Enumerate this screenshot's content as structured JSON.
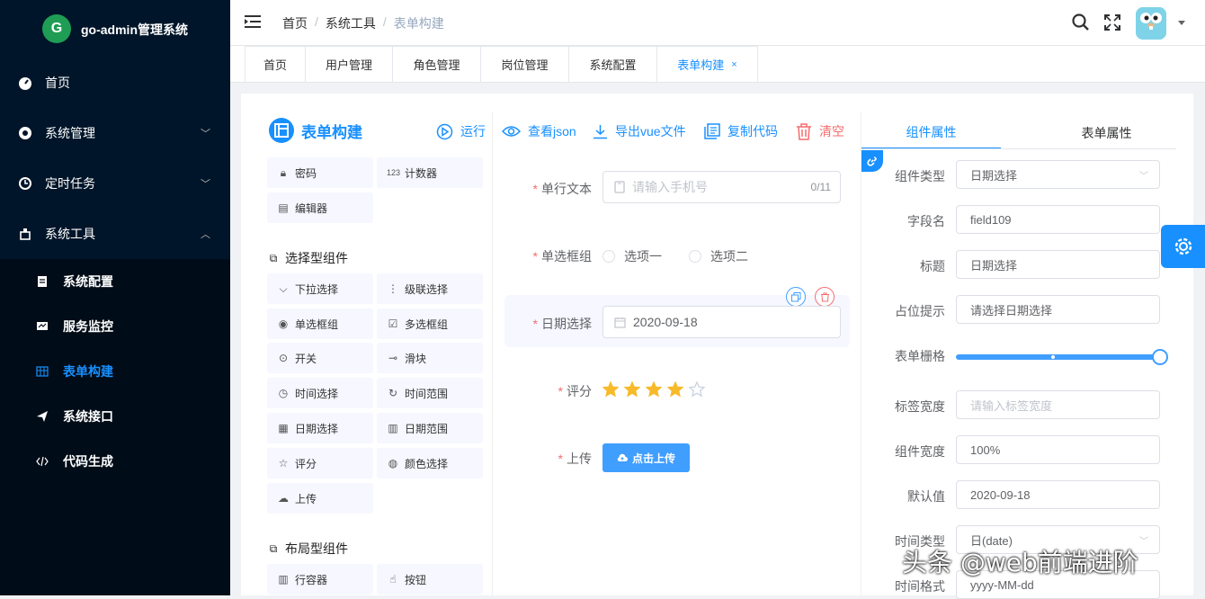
{
  "app": {
    "name": "go-admin管理系统",
    "logo_letter": "G"
  },
  "sidebar": {
    "items": [
      {
        "label": "首页",
        "icon": "dashboard-icon"
      },
      {
        "label": "系统管理",
        "icon": "gear-icon"
      },
      {
        "label": "定时任务",
        "icon": "clock-icon"
      },
      {
        "label": "系统工具",
        "icon": "tool-icon"
      }
    ],
    "sub_items": [
      {
        "label": "系统配置",
        "icon": "config-icon"
      },
      {
        "label": "服务监控",
        "icon": "monitor-icon"
      },
      {
        "label": "表单构建",
        "icon": "table-icon"
      },
      {
        "label": "系统接口",
        "icon": "send-icon"
      },
      {
        "label": "代码生成",
        "icon": "code-icon"
      }
    ]
  },
  "breadcrumb": [
    "首页",
    "系统工具",
    "表单构建"
  ],
  "breadcrumb_sep": "/",
  "tabs": [
    "首页",
    "用户管理",
    "角色管理",
    "岗位管理",
    "系统配置",
    "表单构建"
  ],
  "tab_close": "×",
  "builder": {
    "title": "表单构建",
    "toolbar": {
      "run": "运行",
      "json": "查看json",
      "export": "导出vue文件",
      "copy": "复制代码",
      "clear": "清空"
    }
  },
  "components": {
    "input_group": [
      {
        "label": "密码",
        "icon": "lock-icon"
      },
      {
        "label": "计数器",
        "icon": "counter-icon"
      },
      {
        "label": "编辑器",
        "icon": "editor-icon"
      }
    ],
    "select_title": "选择型组件",
    "select_group": [
      {
        "label": "下拉选择",
        "icon": "select-icon"
      },
      {
        "label": "级联选择",
        "icon": "cascader-icon"
      },
      {
        "label": "单选框组",
        "icon": "radio-icon"
      },
      {
        "label": "多选框组",
        "icon": "checkbox-icon"
      },
      {
        "label": "开关",
        "icon": "switch-icon"
      },
      {
        "label": "滑块",
        "icon": "slider-icon"
      },
      {
        "label": "时间选择",
        "icon": "time-icon"
      },
      {
        "label": "时间范围",
        "icon": "time-range-icon"
      },
      {
        "label": "日期选择",
        "icon": "date-icon"
      },
      {
        "label": "日期范围",
        "icon": "date-range-icon"
      },
      {
        "label": "评分",
        "icon": "star-icon"
      },
      {
        "label": "颜色选择",
        "icon": "palette-icon"
      },
      {
        "label": "上传",
        "icon": "upload-icon"
      }
    ],
    "layout_title": "布局型组件",
    "layout_group": [
      {
        "label": "行容器",
        "icon": "row-icon"
      },
      {
        "label": "按钮",
        "icon": "button-icon"
      }
    ]
  },
  "form": {
    "text": {
      "label": "单行文本",
      "placeholder": "请输入手机号",
      "counter": "0/11"
    },
    "radio": {
      "label": "单选框组",
      "options": [
        "选项一",
        "选项二"
      ]
    },
    "date": {
      "label": "日期选择",
      "value": "2020-09-18"
    },
    "rate": {
      "label": "评分",
      "value": 4,
      "max": 5
    },
    "upload": {
      "label": "上传",
      "button": "点击上传"
    },
    "required_mark": "*"
  },
  "props_tabs": [
    "组件属性",
    "表单属性"
  ],
  "props": {
    "type": {
      "label": "组件类型",
      "value": "日期选择"
    },
    "field": {
      "label": "字段名",
      "value": "field109"
    },
    "title": {
      "label": "标题",
      "value": "日期选择"
    },
    "placeholder": {
      "label": "占位提示",
      "value": "请选择日期选择"
    },
    "grid": {
      "label": "表单栅格",
      "value": 24,
      "max": 24
    },
    "label_width": {
      "label": "标签宽度",
      "placeholder": "请输入标签宽度"
    },
    "width": {
      "label": "组件宽度",
      "value": "100%"
    },
    "default": {
      "label": "默认值",
      "value": "2020-09-18"
    },
    "time_type": {
      "label": "时间类型",
      "value": "日(date)"
    },
    "time_format": {
      "label": "时间格式",
      "value": "yyyy-MM-dd"
    }
  },
  "watermark": "头条 @web前端进阶",
  "colors": {
    "primary": "#1890ff",
    "sidebar": "#001529",
    "danger": "#f56c6c",
    "star": "#f7ba2a"
  }
}
